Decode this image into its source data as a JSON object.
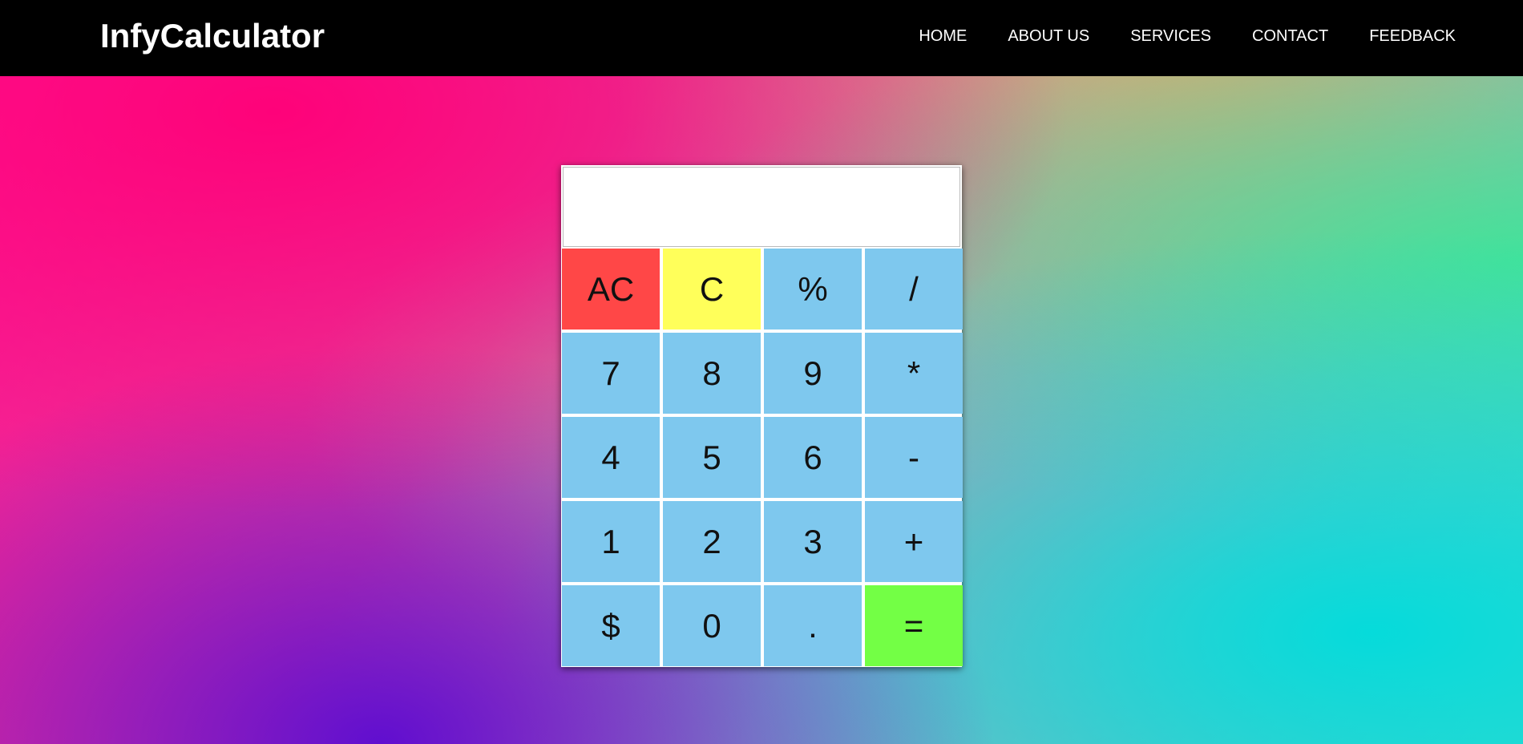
{
  "navbar": {
    "brand": "InfyCalculator",
    "links": [
      "HOME",
      "ABOUT US",
      "SERVICES",
      "CONTACT",
      "FEEDBACK"
    ]
  },
  "calculator": {
    "display_value": "",
    "keys": [
      {
        "label": "AC",
        "type": "clear-all",
        "color": "#ff4747"
      },
      {
        "label": "C",
        "type": "clear",
        "color": "#ffff5a"
      },
      {
        "label": "%",
        "type": "operator",
        "color": "#7ec8ee"
      },
      {
        "label": "/",
        "type": "operator",
        "color": "#7ec8ee"
      },
      {
        "label": "7",
        "type": "digit",
        "color": "#7ec8ee"
      },
      {
        "label": "8",
        "type": "digit",
        "color": "#7ec8ee"
      },
      {
        "label": "9",
        "type": "digit",
        "color": "#7ec8ee"
      },
      {
        "label": "*",
        "type": "operator",
        "color": "#7ec8ee"
      },
      {
        "label": "4",
        "type": "digit",
        "color": "#7ec8ee"
      },
      {
        "label": "5",
        "type": "digit",
        "color": "#7ec8ee"
      },
      {
        "label": "6",
        "type": "digit",
        "color": "#7ec8ee"
      },
      {
        "label": "-",
        "type": "operator",
        "color": "#7ec8ee"
      },
      {
        "label": "1",
        "type": "digit",
        "color": "#7ec8ee"
      },
      {
        "label": "2",
        "type": "digit",
        "color": "#7ec8ee"
      },
      {
        "label": "3",
        "type": "digit",
        "color": "#7ec8ee"
      },
      {
        "label": "+",
        "type": "operator",
        "color": "#7ec8ee"
      },
      {
        "label": "$",
        "type": "symbol",
        "color": "#7ec8ee"
      },
      {
        "label": "0",
        "type": "digit",
        "color": "#7ec8ee"
      },
      {
        "label": ".",
        "type": "decimal",
        "color": "#7ec8ee"
      },
      {
        "label": "=",
        "type": "equals",
        "color": "#73ff45"
      }
    ]
  }
}
